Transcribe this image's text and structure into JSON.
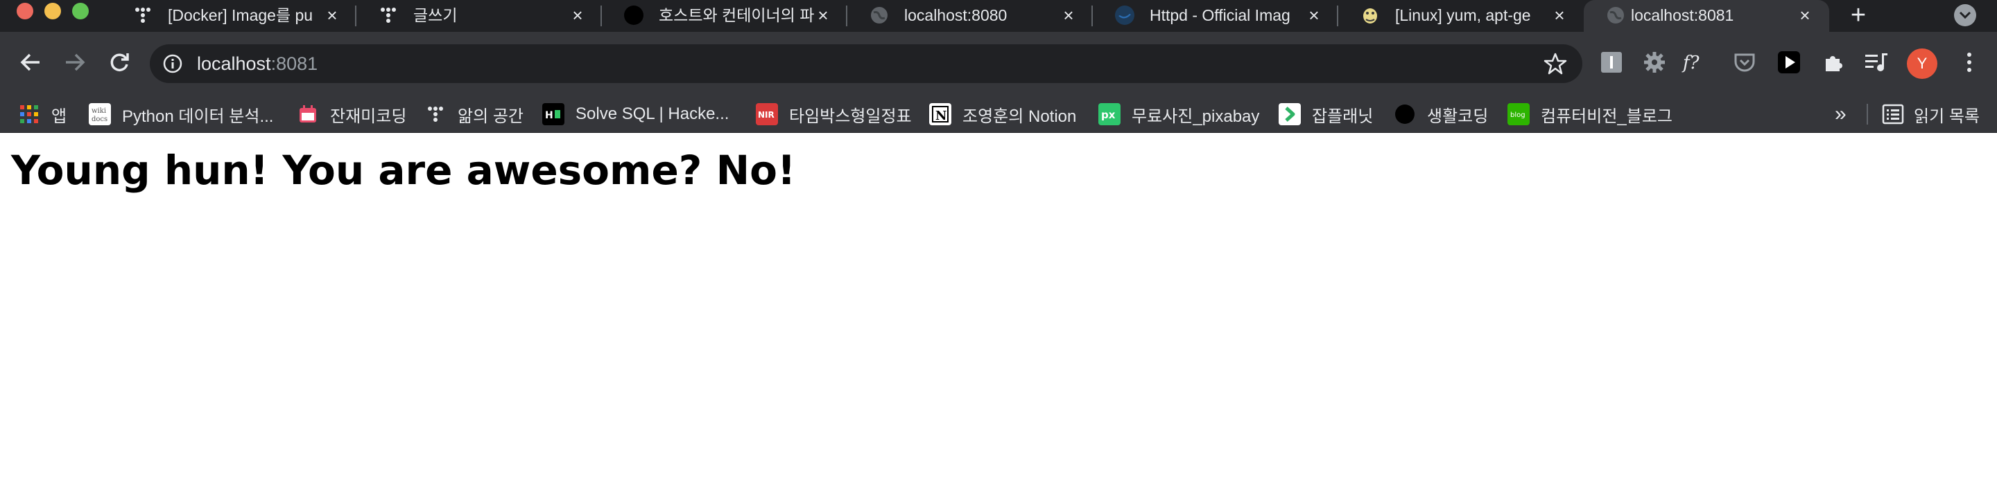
{
  "tabs": [
    {
      "title": "[Docker] Image를 pu",
      "favicon": "tistory-icon"
    },
    {
      "title": "글쓰기",
      "favicon": "tistory-icon"
    },
    {
      "title": "호스트와 컨테이너의 파",
      "favicon": "black-circle-icon"
    },
    {
      "title": "localhost:8080",
      "favicon": "globe-icon"
    },
    {
      "title": "Httpd - Official Imag",
      "favicon": "docker-icon"
    },
    {
      "title": "[Linux] yum, apt-ge",
      "favicon": "python-icon"
    },
    {
      "title": "localhost:8081",
      "favicon": "globe-icon",
      "active": true
    }
  ],
  "omnibox": {
    "host": "localhost",
    "port": ":8081"
  },
  "profile": {
    "initial": "Y"
  },
  "bookmarks": [
    {
      "label": "앱",
      "icon": "apps-grid-icon"
    },
    {
      "label": "Python 데이터 분석...",
      "icon": "wikidocs-icon"
    },
    {
      "label": "잔재미코딩",
      "icon": "calendar-icon"
    },
    {
      "label": "앎의 공간",
      "icon": "tistory-icon"
    },
    {
      "label": "Solve SQL | Hacke...",
      "icon": "hackerrank-icon"
    },
    {
      "label": "타임박스형일정표",
      "icon": "nir-icon"
    },
    {
      "label": "조영훈의 Notion",
      "icon": "notion-icon"
    },
    {
      "label": "무료사진_pixabay",
      "icon": "pixabay-icon"
    },
    {
      "label": "잡플래닛",
      "icon": "jobplanet-icon"
    },
    {
      "label": "생활코딩",
      "icon": "black-circle-icon"
    },
    {
      "label": "컴퓨터비전_블로그",
      "icon": "blog-icon"
    }
  ],
  "bookmarks_more": "»",
  "reading_list": {
    "label": "읽기 목록"
  },
  "page": {
    "heading": "Young hun! You are awesome? No!"
  },
  "colors": {
    "tabstrip_bg": "#202124",
    "toolbar_bg": "#35363a",
    "avatar_bg": "#e8553c",
    "text_light": "#e8eaed"
  }
}
